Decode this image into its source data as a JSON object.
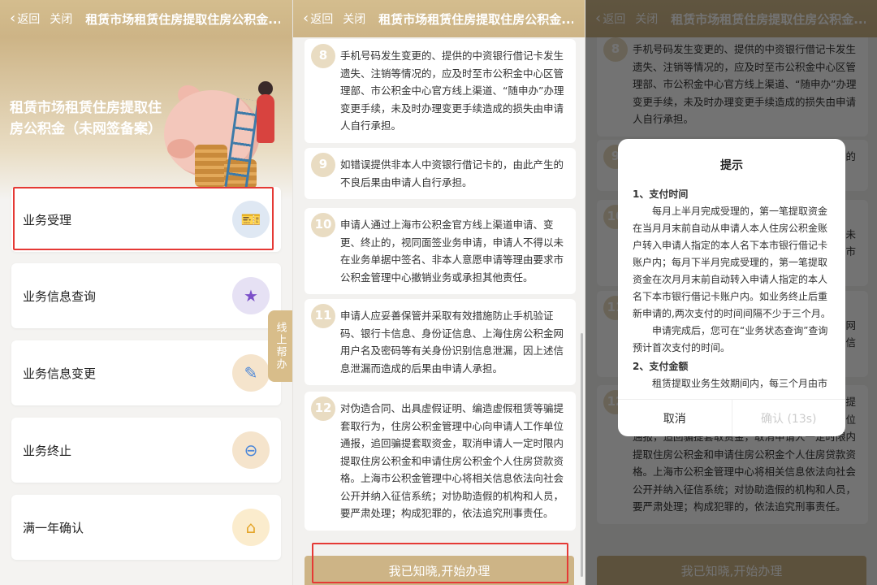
{
  "nav": {
    "back": "返回",
    "close": "关闭",
    "title": "租赁市场租赁住房提取住房公积金..."
  },
  "hero": {
    "title": "租赁市场租赁住房提取住房公积金（未网签备案）"
  },
  "menu": [
    {
      "label": "业务受理",
      "icon": "ticket-icon"
    },
    {
      "label": "业务信息查询",
      "icon": "cards-icon"
    },
    {
      "label": "业务信息变更",
      "icon": "phone-edit-icon"
    },
    {
      "label": "业务终止",
      "icon": "phone-stop-icon"
    },
    {
      "label": "满一年确认",
      "icon": "house-yen-icon"
    }
  ],
  "help": "线上帮办",
  "items": [
    {
      "num": "8",
      "text": "手机号码发生变更的、提供的中资银行借记卡发生遗失、注销等情况的，应及时至市公积金中心区管理部、市公积金中心官方线上渠道、“随申办”办理变更手续，未及时办理变更手续造成的损失由申请人自行承担。"
    },
    {
      "num": "9",
      "text": "如错误提供非本人中资银行借记卡的，由此产生的不良后果由申请人自行承担。"
    },
    {
      "num": "10",
      "text": "申请人通过上海市公积金官方线上渠道申请、变更、终止的，视同面签业务申请，申请人不得以未在业务单据中签名、非本人意愿申请等理由要求市公积金管理中心撤销业务或承担其他责任。"
    },
    {
      "num": "11",
      "text": "申请人应妥善保管并采取有效措施防止手机验证码、银行卡信息、身份证信息、上海住房公积金网用户名及密码等有关身份识别信息泄漏，因上述信息泄漏而造成的后果由申请人承担。"
    },
    {
      "num": "12",
      "text": "对伪造合同、出具虚假证明、编造虚假租赁等骗提套取行为，住房公积金管理中心向申请人工作单位通报，追回骗提套取资金，取消申请人一定时限内提取住房公积金和申请住房公积金个人住房贷款资格。上海市公积金管理中心将相关信息依法向社会公开并纳入征信系统；对协助造假的机构和人员，要严肃处理；构成犯罪的，依法追究刑事责任。"
    }
  ],
  "confirm_button": "我已知晓,开始办理",
  "dialog": {
    "title": "提示",
    "h1": "1、支付时间",
    "p1": "每月上半月完成受理的，第一笔提取资金在当月月末前自动从申请人本人住房公积金账户转入申请人指定的本人名下本市银行借记卡账户内；每月下半月完成受理的，第一笔提取资金在次月月末前自动转入申请人指定的本人名下本市银行借记卡账户内。如业务终止后重新申请的,两次支付的时间间隔不少于三个月。",
    "p2": "申请完成后，您可在“业务状态查询”查询预计首次支付的时间。",
    "h2": "2、支付金额",
    "p3": "租赁提取业务生效期间内，每三个月由市",
    "cancel": "取消",
    "ok": "确认 (13s)"
  },
  "colors": {
    "gold": "#cdb486",
    "highlight": "#e53935"
  }
}
